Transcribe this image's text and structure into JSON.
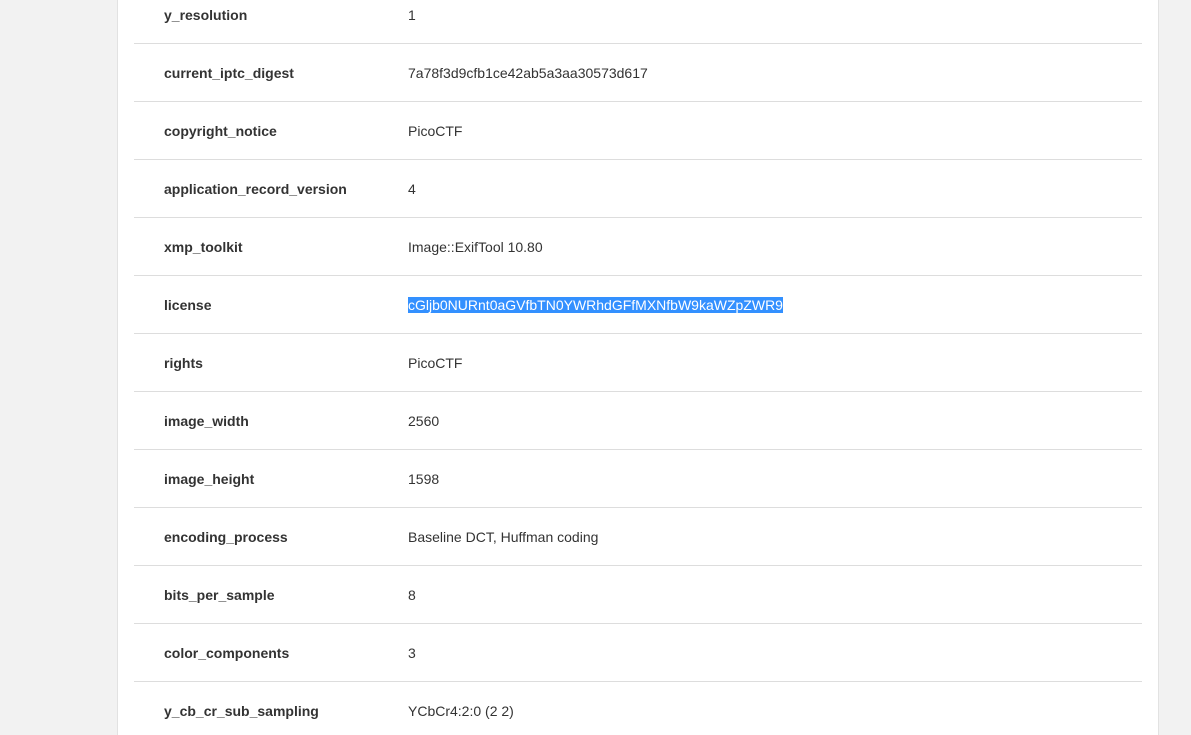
{
  "metadata": {
    "rows": [
      {
        "key": "y_resolution",
        "value": "1"
      },
      {
        "key": "current_iptc_digest",
        "value": "7a78f3d9cfb1ce42ab5a3aa30573d617"
      },
      {
        "key": "copyright_notice",
        "value": "PicoCTF"
      },
      {
        "key": "application_record_version",
        "value": "4"
      },
      {
        "key": "xmp_toolkit",
        "value": "Image::ExifTool 10.80"
      },
      {
        "key": "license",
        "value": "cGljb0NURnt0aGVfbTN0YWRhdGFfMXNfbW9kaWZpZWR9",
        "selected": true
      },
      {
        "key": "rights",
        "value": "PicoCTF"
      },
      {
        "key": "image_width",
        "value": "2560"
      },
      {
        "key": "image_height",
        "value": "1598"
      },
      {
        "key": "encoding_process",
        "value": "Baseline DCT, Huffman coding"
      },
      {
        "key": "bits_per_sample",
        "value": "8"
      },
      {
        "key": "color_components",
        "value": "3"
      },
      {
        "key": "y_cb_cr_sub_sampling",
        "value": "YCbCr4:2:0 (2 2)"
      }
    ]
  },
  "colors": {
    "page_background": "#f2f2f2",
    "card_background": "#ffffff",
    "row_divider": "#dddddd",
    "selection_highlight": "#3390ff",
    "selection_text": "#ffffff"
  }
}
